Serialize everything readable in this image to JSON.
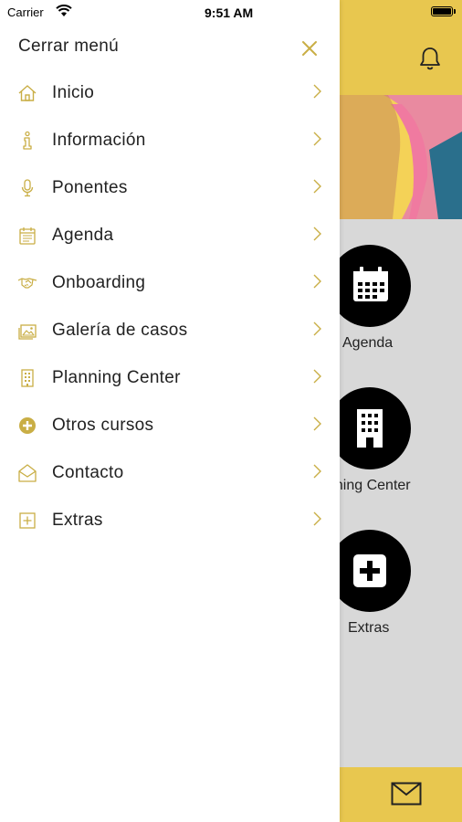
{
  "status_bar": {
    "carrier": "Carrier",
    "time": "9:51 AM"
  },
  "colors": {
    "accent": "#c9ae45",
    "header_yellow": "#e8c74f"
  },
  "drawer": {
    "title": "Cerrar menú",
    "close_icon": "close-icon",
    "items": [
      {
        "label": "Inicio",
        "icon": "home-icon"
      },
      {
        "label": "Información",
        "icon": "info-icon"
      },
      {
        "label": "Ponentes",
        "icon": "microphone-icon"
      },
      {
        "label": "Agenda",
        "icon": "calendar-icon"
      },
      {
        "label": "Onboarding",
        "icon": "handshake-icon"
      },
      {
        "label": "Galería de casos",
        "icon": "gallery-icon"
      },
      {
        "label": "Planning Center",
        "icon": "building-icon"
      },
      {
        "label": "Otros cursos",
        "icon": "plus-circle-icon"
      },
      {
        "label": "Contacto",
        "icon": "mail-open-icon"
      },
      {
        "label": "Extras",
        "icon": "plus-square-icon"
      }
    ]
  },
  "background": {
    "tiles": [
      {
        "label": "Agenda",
        "icon": "calendar-icon"
      },
      {
        "label": "nning Center",
        "icon": "building-icon"
      },
      {
        "label": "Extras",
        "icon": "plus-square-icon"
      }
    ]
  }
}
